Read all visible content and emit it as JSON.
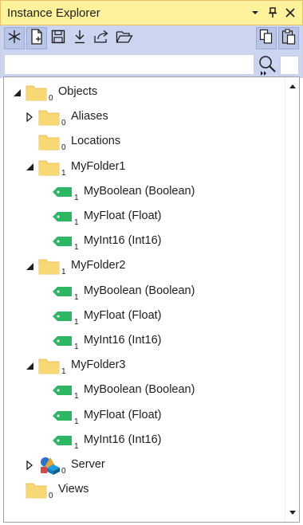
{
  "window": {
    "title": "Instance Explorer"
  },
  "titlebar_buttons": [
    {
      "name": "dropdown-arrow-icon",
      "glyph": "▾"
    },
    {
      "name": "pin-icon",
      "glyph": "⊥"
    },
    {
      "name": "close-icon",
      "glyph": "✕"
    }
  ],
  "search": {
    "value": "",
    "placeholder": ""
  },
  "tree": [
    {
      "label": "Objects",
      "count": "0",
      "icon": "folder-icon",
      "expander": "expanded",
      "level": 0
    },
    {
      "label": "Aliases",
      "count": "0",
      "icon": "folder-icon",
      "expander": "collapsed",
      "level": 1
    },
    {
      "label": "Locations",
      "count": "0",
      "icon": "folder-icon",
      "expander": "none",
      "level": 1
    },
    {
      "label": "MyFolder1",
      "count": "1",
      "icon": "folder-icon",
      "expander": "expanded",
      "level": 1
    },
    {
      "label": "MyBoolean (Boolean)",
      "count": "1",
      "icon": "tag-icon",
      "expander": "none",
      "level": 2
    },
    {
      "label": "MyFloat (Float)",
      "count": "1",
      "icon": "tag-icon",
      "expander": "none",
      "level": 2
    },
    {
      "label": "MyInt16 (Int16)",
      "count": "1",
      "icon": "tag-icon",
      "expander": "none",
      "level": 2
    },
    {
      "label": "MyFolder2",
      "count": "1",
      "icon": "folder-icon",
      "expander": "expanded",
      "level": 1
    },
    {
      "label": "MyBoolean (Boolean)",
      "count": "1",
      "icon": "tag-icon",
      "expander": "none",
      "level": 2
    },
    {
      "label": "MyFloat (Float)",
      "count": "1",
      "icon": "tag-icon",
      "expander": "none",
      "level": 2
    },
    {
      "label": "MyInt16 (Int16)",
      "count": "1",
      "icon": "tag-icon",
      "expander": "none",
      "level": 2
    },
    {
      "label": "MyFolder3",
      "count": "1",
      "icon": "folder-icon",
      "expander": "expanded",
      "level": 1
    },
    {
      "label": "MyBoolean (Boolean)",
      "count": "1",
      "icon": "tag-icon",
      "expander": "none",
      "level": 2
    },
    {
      "label": "MyFloat (Float)",
      "count": "1",
      "icon": "tag-icon",
      "expander": "none",
      "level": 2
    },
    {
      "label": "MyInt16 (Int16)",
      "count": "1",
      "icon": "tag-icon",
      "expander": "none",
      "level": 2
    },
    {
      "label": "Server",
      "count": "0",
      "icon": "server-shapes-icon",
      "expander": "collapsed",
      "level": 1
    },
    {
      "label": "Views",
      "count": "0",
      "icon": "folder-icon",
      "expander": "none",
      "level": 0
    }
  ],
  "colors": {
    "titlebar_bg": "#fff29d",
    "toolbar_bg": "#ccd5f0",
    "folder": "#f8d775",
    "tag": "#2db764"
  }
}
